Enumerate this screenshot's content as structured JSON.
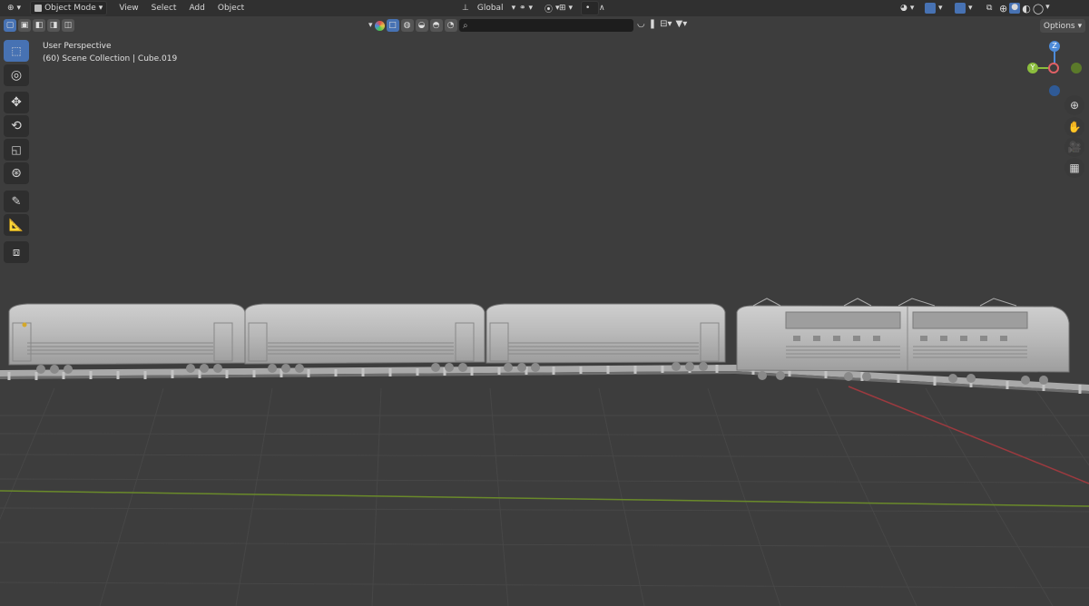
{
  "header": {
    "mode_label": "Object Mode",
    "menus": [
      "View",
      "Select",
      "Add",
      "Object"
    ],
    "transform_orientation": "Global"
  },
  "viewport": {
    "perspective_label": "User Perspective",
    "collection_label": "(60) Scene Collection | Cube.019"
  },
  "options_label": "Options",
  "search": {
    "placeholder": ""
  },
  "gizmo": {
    "z_label": "Z",
    "y_label": "Y",
    "x_label": "X"
  },
  "colors": {
    "accent": "#4772b3",
    "x_axis": "#e06065",
    "y_axis": "#8bbd3d",
    "z_axis": "#4d8bd9"
  },
  "icons": [
    "select-box-icon",
    "cursor-icon",
    "move-icon",
    "rotate-icon",
    "scale-icon",
    "transform-icon",
    "annotate-icon",
    "measure-icon",
    "add-cube-icon",
    "zoom-icon",
    "hand-icon",
    "camera-icon",
    "grid-icon"
  ]
}
